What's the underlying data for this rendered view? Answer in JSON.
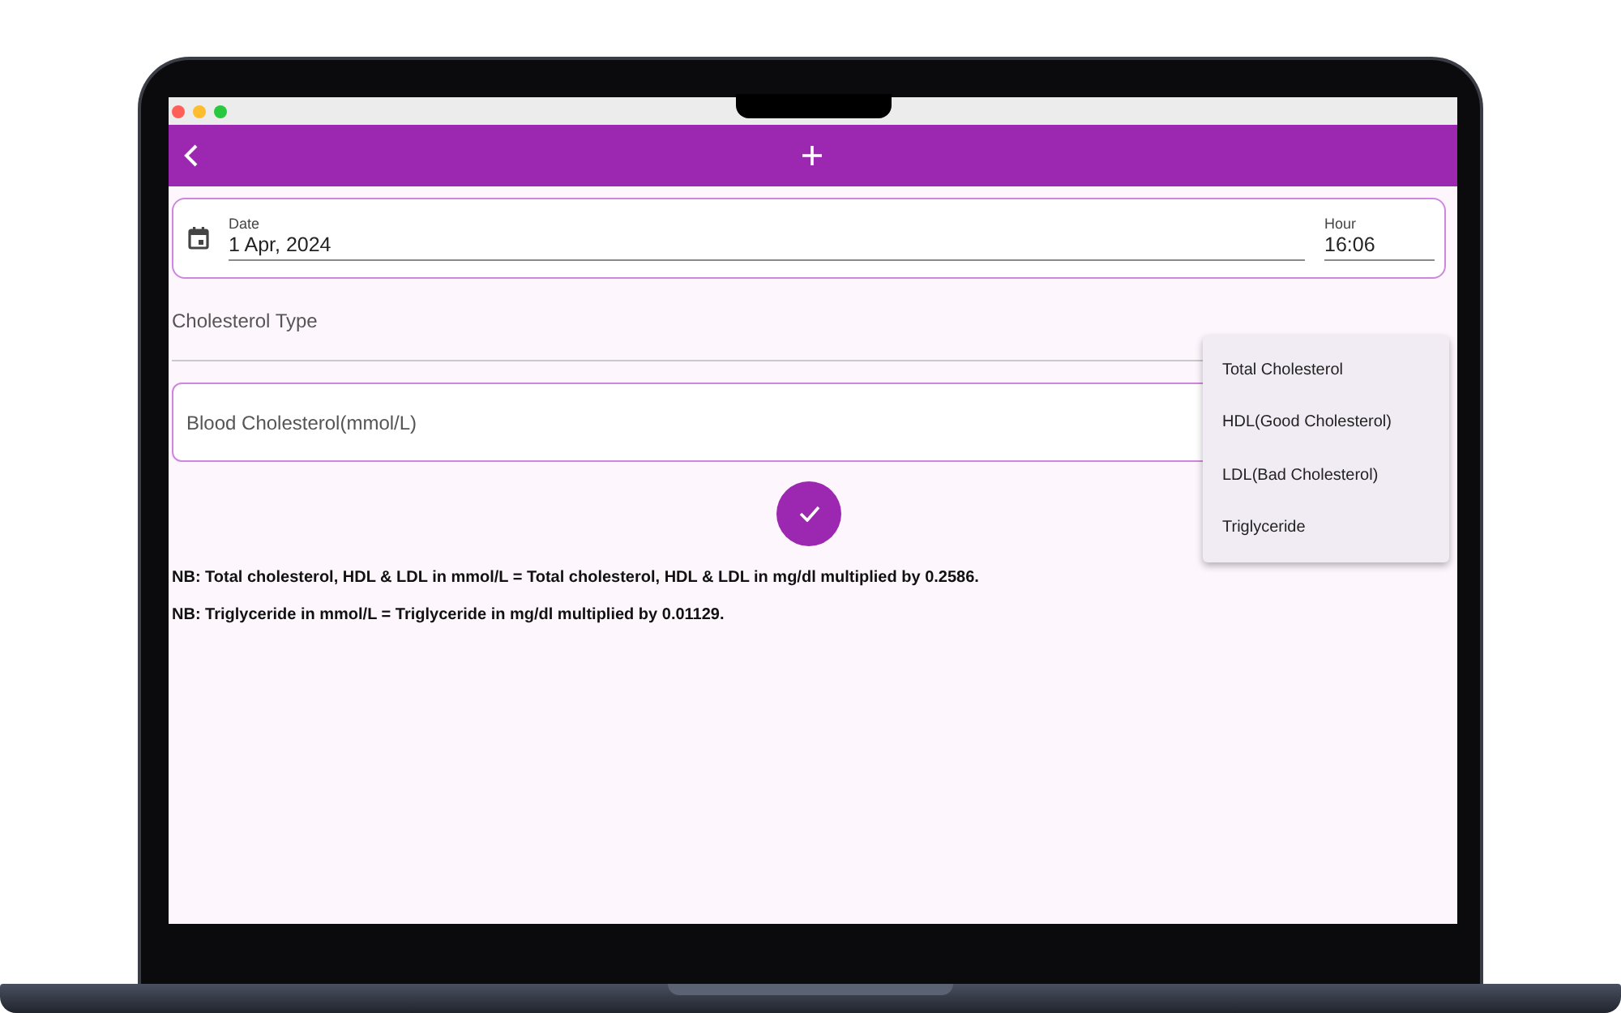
{
  "date_field": {
    "label": "Date",
    "value": "1 Apr, 2024"
  },
  "hour_field": {
    "label": "Hour",
    "value": "16:06"
  },
  "cholesterol_type": {
    "placeholder": "Cholesterol Type",
    "expanded": true,
    "menu": [
      {
        "label": "Total Cholesterol"
      },
      {
        "label": "HDL(Good Cholesterol)"
      },
      {
        "label": "LDL(Bad Cholesterol)"
      },
      {
        "label": "Triglyceride"
      }
    ]
  },
  "blood_cholesterol": {
    "placeholder": "Blood Cholesterol(mmol/L)"
  },
  "notes": [
    "NB: Total cholesterol, HDL & LDL in mmol/L = Total cholesterol, HDL & LDL in mg/dl multiplied by 0.2586.",
    "NB: Triglyceride in mmol/L = Triglyceride in mg/dl multiplied by 0.01129."
  ]
}
